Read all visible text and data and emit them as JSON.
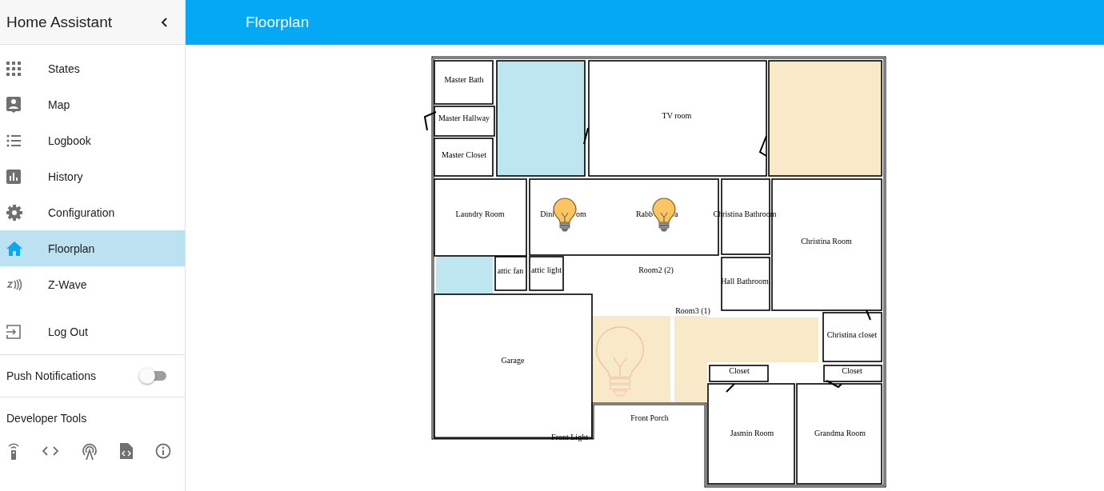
{
  "sidebar": {
    "title": "Home Assistant",
    "items": [
      {
        "label": "States",
        "selected": false
      },
      {
        "label": "Map",
        "selected": false
      },
      {
        "label": "Logbook",
        "selected": false
      },
      {
        "label": "History",
        "selected": false
      },
      {
        "label": "Configuration",
        "selected": false
      },
      {
        "label": "Floorplan",
        "selected": true
      },
      {
        "label": "Z-Wave",
        "selected": false
      }
    ],
    "logout": {
      "label": "Log Out"
    },
    "push_notifications": {
      "label": "Push Notifications",
      "on": false
    },
    "developer_tools": {
      "title": "Developer Tools"
    }
  },
  "header": {
    "title": "Floorplan"
  },
  "floorplan": {
    "highlights": [
      {
        "color": "#bde6f0"
      },
      {
        "color": "#f8e9c9"
      },
      {
        "color": "#bde6f0"
      },
      {
        "color": "#f8e9c9"
      },
      {
        "color": "#f8e9c9"
      },
      {
        "color": "#f8e9c9"
      }
    ],
    "labels": [
      "Master Bath",
      "Master Hallway",
      "Master Closet",
      "TV room",
      "Laundry Room",
      "Dini",
      "om",
      "Rabb",
      "a",
      "Christina Bathroom",
      "Christina Room",
      "attic fan",
      "attic light",
      "Room2 (2)",
      "Hall Bathroom",
      "Room3 (1)",
      "Garage",
      "Christina closet",
      "Closet",
      "Closet",
      "Front Porch",
      "Jasmin Room",
      "Grandma Room",
      "Front Light"
    ],
    "lights": [
      {
        "on": true
      },
      {
        "on": true
      },
      {
        "on": false
      }
    ]
  }
}
